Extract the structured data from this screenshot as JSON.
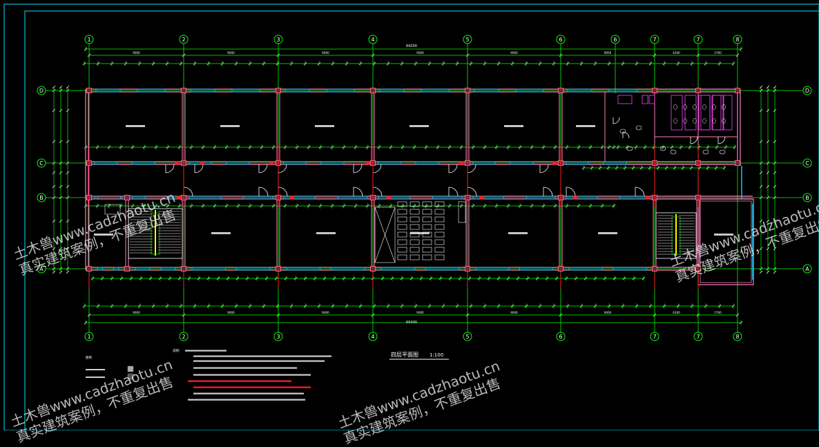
{
  "drawing": {
    "title": "四层平面图",
    "scale": "1:100",
    "total_dimension": "65400",
    "upper_totals": [
      "64200"
    ],
    "axes_numbers": [
      "1",
      "2",
      "3",
      "4",
      "5",
      "6",
      "7",
      "8"
    ],
    "axes_letters": [
      "D",
      "C",
      "B",
      "A"
    ],
    "bay_dimensions": [
      "9000",
      "9000",
      "9000",
      "9000",
      "9000",
      "9000",
      "4200",
      "2700"
    ],
    "notes_heading": "说明：",
    "legend_heading": "图例",
    "colors": {
      "background": "#000000",
      "border": "#00e5ff",
      "axis": "#00ff00",
      "wall": "#ff80c0",
      "window": "#00c8ff",
      "red": "#ff2020",
      "white": "#ffffff",
      "magenta": "#ff40ff",
      "yellow": "#ffff00"
    }
  },
  "watermarks": [
    {
      "line1": "土木兽www.cadzhaotu.cn",
      "line2": "真实建筑案例，不重复出售"
    },
    {
      "line1": "土木兽www.cadzhaotu.cn",
      "line2": "真实建筑案例，不重复出售"
    },
    {
      "line1": "土木兽www.cadzhaotu.cn",
      "line2": "真实建筑案例，不重复出售"
    },
    {
      "line1": "土木兽www.cadzhaotu.cn",
      "line2": "真实建筑案例，不重复出售"
    }
  ]
}
